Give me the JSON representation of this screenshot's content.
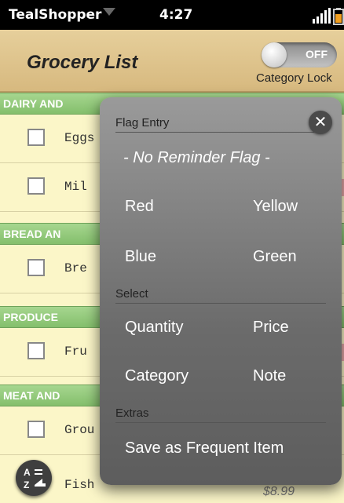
{
  "status": {
    "app_name": "TealShopper",
    "time": "4:27"
  },
  "header": {
    "title": "Grocery List",
    "lock_state": "OFF",
    "lock_label": "Category Lock"
  },
  "list": {
    "categories": [
      "DAIRY AND",
      "BREAD AN",
      "PRODUCE",
      "MEAT AND"
    ],
    "items": [
      "Eggs",
      "Mil",
      "Bre",
      "Fru",
      "Grou",
      "Fish"
    ],
    "price": "$8.99"
  },
  "popup": {
    "flag_title": "Flag Entry",
    "no_flag": "- No Reminder Flag -",
    "flags": [
      "Red",
      "Yellow",
      "Blue",
      "Green"
    ],
    "select_title": "Select",
    "select_items": [
      "Quantity",
      "Price",
      "Category",
      "Note"
    ],
    "extras_title": "Extras",
    "extras_item": "Save as Frequent Item"
  },
  "colors": {
    "category_green": "#84bf6c",
    "list_bg": "#fbf6c8",
    "header_tan": "#e6cf9b"
  }
}
